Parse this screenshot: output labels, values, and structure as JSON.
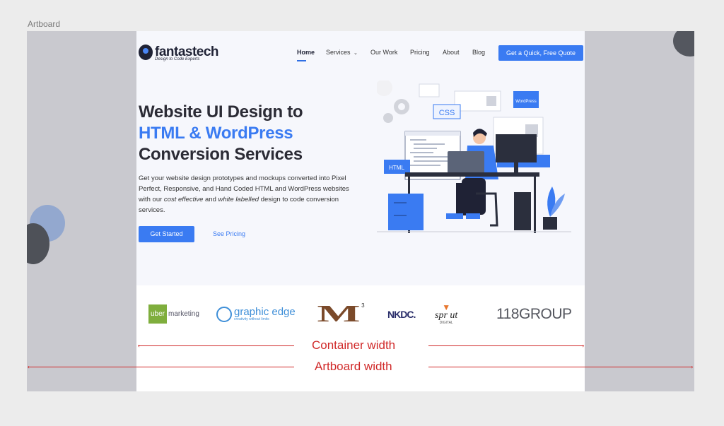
{
  "artboard_label": "Artboard",
  "header": {
    "logo_text": "fantastech",
    "logo_tagline": "Design to Code Experts",
    "nav": [
      "Home",
      "Services",
      "Our Work",
      "Pricing",
      "About",
      "Blog"
    ],
    "cta_label": "Get a Quick, Free Quote"
  },
  "hero": {
    "title_line1": "Website UI Design to",
    "title_line2": "HTML & WordPress",
    "title_line3": "Conversion Services",
    "description_part1": "Get your website design prototypes and mockups converted into Pixel Perfect, Responsive, and Hand Coded HTML and WordPress websites with our ",
    "description_em1": "cost effective",
    "description_part2": " and ",
    "description_em2": "white labelled",
    "description_part3": " design to code conversion services.",
    "primary_button": "Get Started",
    "secondary_link": "See Pricing"
  },
  "illustration": {
    "badge_css": "CSS",
    "badge_html": "HTML",
    "badge_wordpress": "WordPress"
  },
  "client_logos": {
    "uber_prefix": "uber",
    "uber_suffix": "marketing",
    "graphic_edge": "graphic edge",
    "graphic_edge_tag": "creativity without limits",
    "m3_mark": "M",
    "m3_sup": "3",
    "nkdc": "NKDC.",
    "sprout": "spr ut",
    "sprout_tag": "DIGITAL",
    "group118": "118GROUP"
  },
  "annotations": {
    "container_width": "Container width",
    "artboard_width": "Artboard width"
  },
  "colors": {
    "accent": "#3a7bf2",
    "annotation": "#d02929",
    "heading": "#2b2b35"
  }
}
